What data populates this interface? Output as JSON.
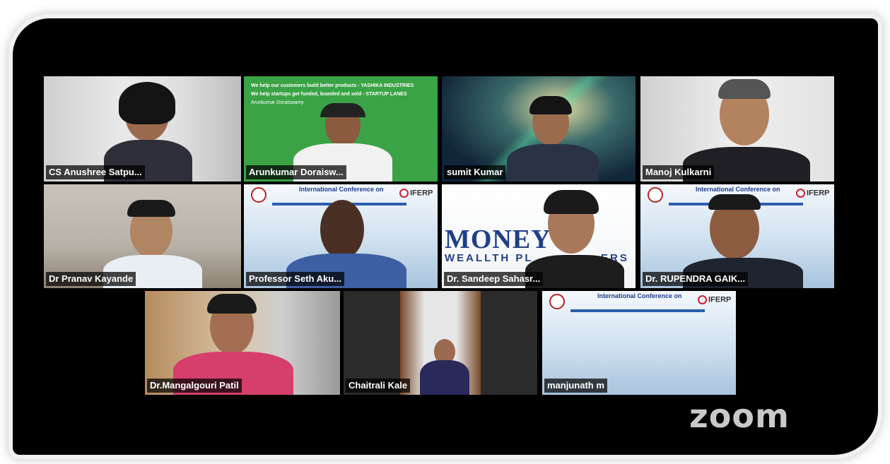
{
  "app": {
    "brand_watermark": "zoom"
  },
  "participants_row1": [
    {
      "name": "CS Anushree Satpu..."
    },
    {
      "name": "Arunkumar Doraisw...",
      "banner_line1": "We help our customers build better products - YASHIKA INDUSTRIES",
      "banner_line2": "We help startups get funded, branded and sold - STARTUP LANES",
      "banner_line3": "Arunkumar Doraiswamy"
    },
    {
      "name": "sumit Kumar"
    },
    {
      "name": "Manoj Kulkarni"
    }
  ],
  "participants_row2": [
    {
      "name": "Dr Pranav Kayande"
    },
    {
      "name": "Professor Seth Aku...",
      "background_title": "International Conference on",
      "logo": "IFERP"
    },
    {
      "name": "Dr. Sandeep Sahasr...",
      "background_brand": "MONEY",
      "background_brand2": "WEALLTH PL",
      "background_brand3": "ERS"
    },
    {
      "name": "Dr. RUPENDRA GAIK...",
      "background_title": "International Conference on",
      "logo": "IFERP"
    }
  ],
  "participants_row3": [
    {
      "name": "Dr.Mangalgouri Patil"
    },
    {
      "name": "Chaitrali Kale"
    },
    {
      "name": "manjunath m",
      "background_title": "International Conference on",
      "logo": "IFERP"
    }
  ],
  "colors": {
    "active_speaker": "#5cd45a",
    "green_screen": "#3aa345",
    "conference_blue": "#1b3a8c"
  }
}
